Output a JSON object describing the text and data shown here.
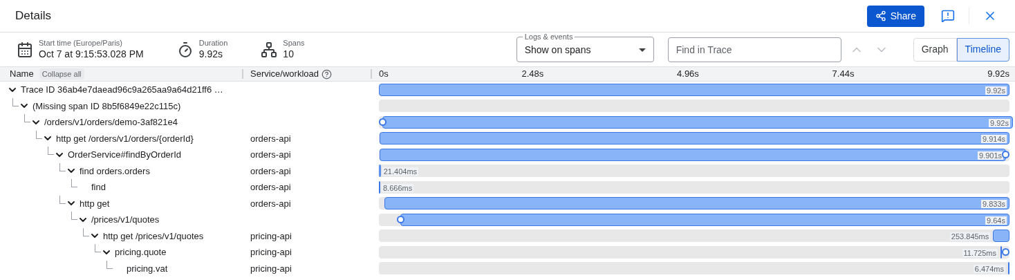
{
  "title": "Details",
  "header_actions": {
    "share": "Share"
  },
  "summary": [
    {
      "kind": "calendar",
      "label": "Start time (Europe/Paris)",
      "value": "Oct 7 at 9:15:53.028 PM"
    },
    {
      "kind": "timer",
      "label": "Duration",
      "value": "9.92s"
    },
    {
      "kind": "spans",
      "label": "Spans",
      "value": "10"
    }
  ],
  "logs_select": {
    "label": "Logs & events",
    "value": "Show on spans"
  },
  "find": {
    "placeholder": "Find in Trace"
  },
  "view_toggle": [
    {
      "label": "Graph",
      "selected": false
    },
    {
      "label": "Timeline",
      "selected": true
    }
  ],
  "columns": {
    "name": "Name",
    "collapse": "Collapse all",
    "service": "Service/workload"
  },
  "axis": [
    "0s",
    "2.48s",
    "4.96s",
    "7.44s",
    "9.92s"
  ],
  "spans": [
    {
      "name": "Trace ID 36ab4e7daead96c9a265aa9a64d21ff6 …",
      "kind": "bar",
      "level": 1,
      "duration": "9.92s",
      "expanded": true,
      "children": [
        {
          "name": "(Missing span ID 8b5f6849e22c115c)",
          "kind": "missing",
          "expanded": true,
          "children": [
            {
              "name": "/orders/v1/orders/demo-3af821e4",
              "kind": "bar",
              "level": 1,
              "duration": "9.92s",
              "event_at_start": true,
              "expanded": true,
              "children": [
                {
                  "name": "http get /orders/v1/orders/{orderId}",
                  "service": "orders-api",
                  "kind": "bar",
                  "level": 0.999,
                  "ends_at_end": true,
                  "duration": "9.914s",
                  "expanded": true,
                  "children": [
                    {
                      "name": "OrderService#findByOrderId",
                      "service": "orders-api",
                      "kind": "bar",
                      "level": 0.993,
                      "ends_at_end": true,
                      "duration": "9.901s",
                      "event_at_end": true,
                      "expanded": true,
                      "children": [
                        {
                          "name": "find orders.orders",
                          "service": "orders-api",
                          "kind": "bar",
                          "level": 0.003,
                          "ends_at_end": false,
                          "duration": "21.404ms",
                          "expanded": true,
                          "children": [
                            {
                              "name": "find",
                              "service": "orders-api",
                              "kind": "bar",
                              "level": 0.002,
                              "ends_at_end": false,
                              "duration": "8.666ms"
                            }
                          ]
                        },
                        {
                          "name": "http get",
                          "service": "orders-api",
                          "kind": "bar",
                          "level": 0.991,
                          "ends_at_end": true,
                          "duration": "9.833s",
                          "expanded": true,
                          "children": [
                            {
                              "name": "/prices/v1/quotes",
                              "kind": "bar",
                              "level": 0.966,
                              "ends_at_end": true,
                              "duration": "9.64s",
                              "event_at_start": true,
                              "expanded": true,
                              "children": [
                                {
                                  "name": "http get /prices/v1/quotes",
                                  "service": "pricing-api",
                                  "kind": "bar",
                                  "level": 0.026,
                                  "ends_at_end": true,
                                  "duration": "253.845ms",
                                  "expanded": true,
                                  "children": [
                                    {
                                      "name": "pricing.quote",
                                      "service": "pricing-api",
                                      "kind": "bar",
                                      "ends_at_end": true,
                                      "duration": "11.725ms",
                                      "event_at_end": true,
                                      "expanded": true,
                                      "children": [
                                        {
                                          "name": "pricing.vat",
                                          "service": "pricing-api",
                                          "kind": "bar",
                                          "level": 0.002,
                                          "ends_at_end": true,
                                          "duration": "6.474ms"
                                        }
                                      ]
                                    }
                                  ]
                                }
                              ]
                            }
                          ]
                        }
                      ]
                    }
                  ]
                }
              ]
            }
          ]
        }
      ]
    }
  ]
}
